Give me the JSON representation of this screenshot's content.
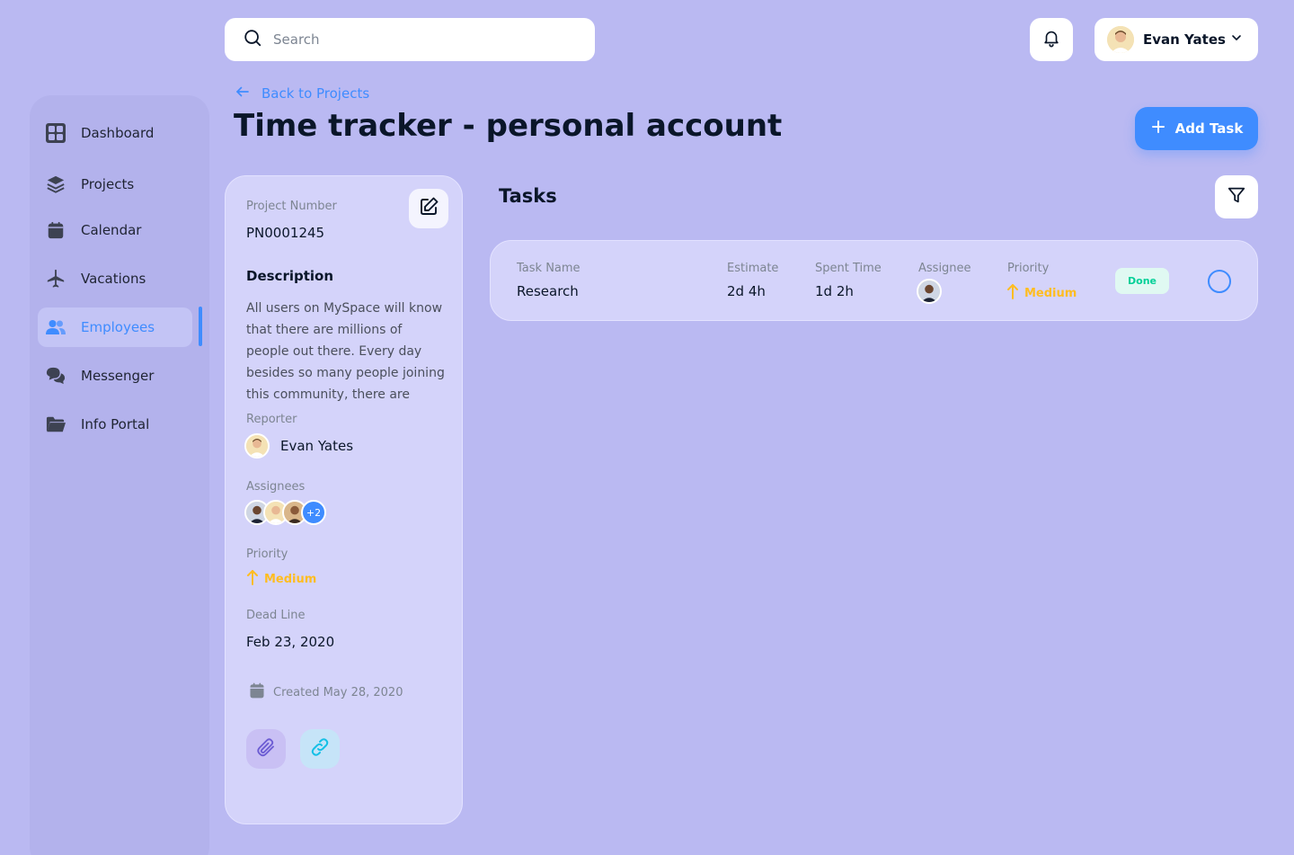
{
  "search": {
    "placeholder": "Search",
    "value": ""
  },
  "header": {
    "user_name": "Evan Yates"
  },
  "sidebar": {
    "items": [
      {
        "label": "Dashboard",
        "icon": "dashboard-icon"
      },
      {
        "label": "Projects",
        "icon": "layers-icon"
      },
      {
        "label": "Calendar",
        "icon": "calendar-icon"
      },
      {
        "label": "Vacations",
        "icon": "airplane-icon"
      },
      {
        "label": "Employees",
        "icon": "users-icon",
        "active": true
      },
      {
        "label": "Messenger",
        "icon": "chat-icon"
      },
      {
        "label": "Info Portal",
        "icon": "folder-icon"
      }
    ]
  },
  "page": {
    "back_label": "Back to Projects",
    "title": "Time tracker - personal account",
    "add_task_label": "Add Task"
  },
  "details": {
    "project_number_label": "Project Number",
    "project_number": "PN0001245",
    "description_title": "Description",
    "description": "All users on MySpace will know that there are millions of people out there. Every day besides so many people joining this community, there are",
    "reporter_label": "Reporter",
    "reporter_name": "Evan Yates",
    "assignees_label": "Assignees",
    "assignees_extra": "+2",
    "priority_label": "Priority",
    "priority_value": "Medium",
    "deadline_label": "Dead Line",
    "deadline_value": "Feb 23, 2020",
    "created_text": "Created May 28, 2020"
  },
  "tasks": {
    "title": "Tasks",
    "headers": {
      "name": "Task Name",
      "estimate": "Estimate",
      "spent": "Spent Time",
      "assignee": "Assignee",
      "priority": "Priority"
    },
    "rows": [
      {
        "name": "Research",
        "estimate": "2d 4h",
        "spent": "1d 2h",
        "priority": "Medium",
        "status": "Done"
      }
    ]
  },
  "colors": {
    "background": "#bab9f2",
    "accent": "#3f8cff",
    "priority_medium": "#ffbd21",
    "status_done": "#00d097"
  }
}
